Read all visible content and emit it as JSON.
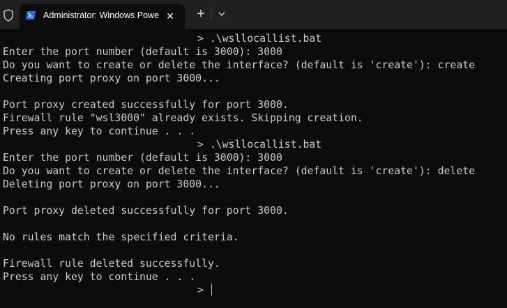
{
  "window": {
    "tab_title": "Administrator: Windows Powe",
    "close_glyph": "✕",
    "new_tab_glyph": "+",
    "icons": [
      "shield-icon",
      "powershell-icon",
      "close-icon",
      "plus-icon",
      "chevron-down-icon"
    ]
  },
  "console": {
    "lines": [
      "> .\\wsllocallist.bat",
      "Enter the port number (default is 3000): 3000",
      "Do you want to create or delete the interface? (default is 'create'): create",
      "Creating port proxy on port 3000...",
      "",
      "Port proxy created successfully for port 3000.",
      "Firewall rule \"wsl3000\" already exists. Skipping creation.",
      "Press any key to continue . . .",
      "> .\\wsllocallist.bat",
      "Enter the port number (default is 3000): 3000",
      "Do you want to create or delete the interface? (default is 'create'): delete",
      "Deleting port proxy on port 3000...",
      "",
      "Port proxy deleted successfully for port 3000.",
      "",
      "No rules match the specified criteria.",
      "",
      "Firewall rule deleted successfully.",
      "Press any key to continue . . .",
      "> "
    ]
  }
}
